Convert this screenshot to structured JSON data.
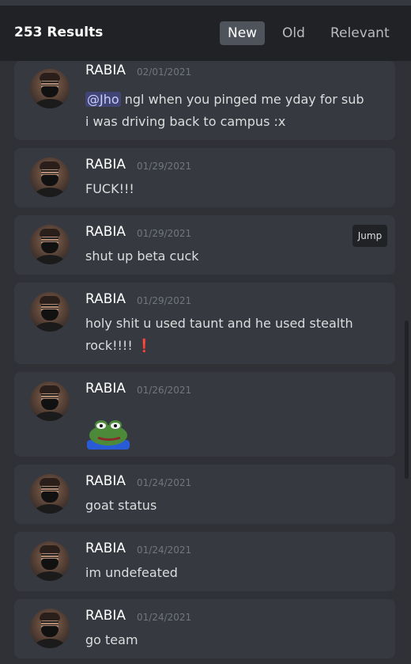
{
  "header": {
    "results_count": "253 Results",
    "sort_tabs": [
      "New",
      "Old",
      "Relevant"
    ],
    "active_tab": "New"
  },
  "messages": [
    {
      "author": "RABIA",
      "date": "02/01/2021",
      "mention": "@Jho",
      "text_line1": " ngl when you pinged me yday for sub",
      "text_line2": "i was driving back to campus :x"
    },
    {
      "author": "RABIA",
      "date": "01/29/2021",
      "text": "FUCK!!!"
    },
    {
      "author": "RABIA",
      "date": "01/29/2021",
      "text": "shut up beta cuck",
      "jump_label": "Jump"
    },
    {
      "author": "RABIA",
      "date": "01/29/2021",
      "text_line1": "holy shit u used taunt and he used stealth",
      "text_line2": "rock!!!! ",
      "emoji": "❗"
    },
    {
      "author": "RABIA",
      "date": "01/26/2021",
      "sticker": "pepe-frog-emote"
    },
    {
      "author": "RABIA",
      "date": "01/24/2021",
      "text": "goat status"
    },
    {
      "author": "RABIA",
      "date": "01/24/2021",
      "text": "im undefeated"
    },
    {
      "author": "RABIA",
      "date": "01/24/2021",
      "text": "go team"
    }
  ],
  "colors": {
    "background": "#2f3136",
    "card": "#36393f",
    "header": "#202225",
    "mention": "#5865f2",
    "active_tab": "#4f545c"
  }
}
